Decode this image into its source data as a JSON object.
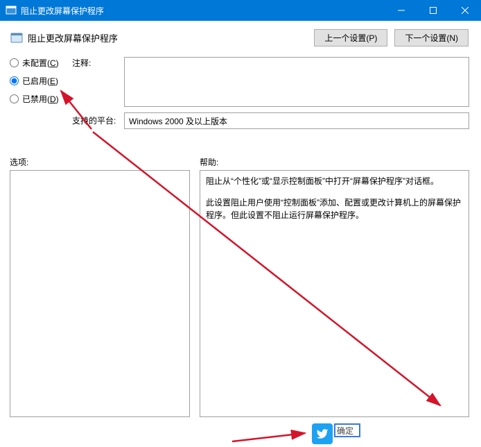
{
  "titlebar": {
    "text": "阻止更改屏幕保护程序"
  },
  "header": {
    "title": "阻止更改屏幕保护程序"
  },
  "nav": {
    "prev": "上一个设置(P)",
    "next": "下一个设置(N)"
  },
  "radios": {
    "not_configured": {
      "pre": "未配置(",
      "accel": "C",
      "post": ")"
    },
    "enabled": {
      "pre": "已启用(",
      "accel": "E",
      "post": ")"
    },
    "disabled": {
      "pre": "已禁用(",
      "accel": "D",
      "post": ")"
    }
  },
  "comment": {
    "label": "注释:",
    "value": ""
  },
  "platform": {
    "label": "支持的平台:",
    "value": "Windows 2000 及以上版本"
  },
  "options": {
    "label": "选项:"
  },
  "help": {
    "label": "帮助:",
    "p1": "阻止从“个性化”或“显示控制面板”中打开“屏幕保护程序”对话框。",
    "p2": "此设置阻止用户使用“控制面板”添加、配置或更改计算机上的屏幕保护程序。但此设置不阻止运行屏幕保护程序。"
  },
  "footer": {
    "text": "确定"
  }
}
